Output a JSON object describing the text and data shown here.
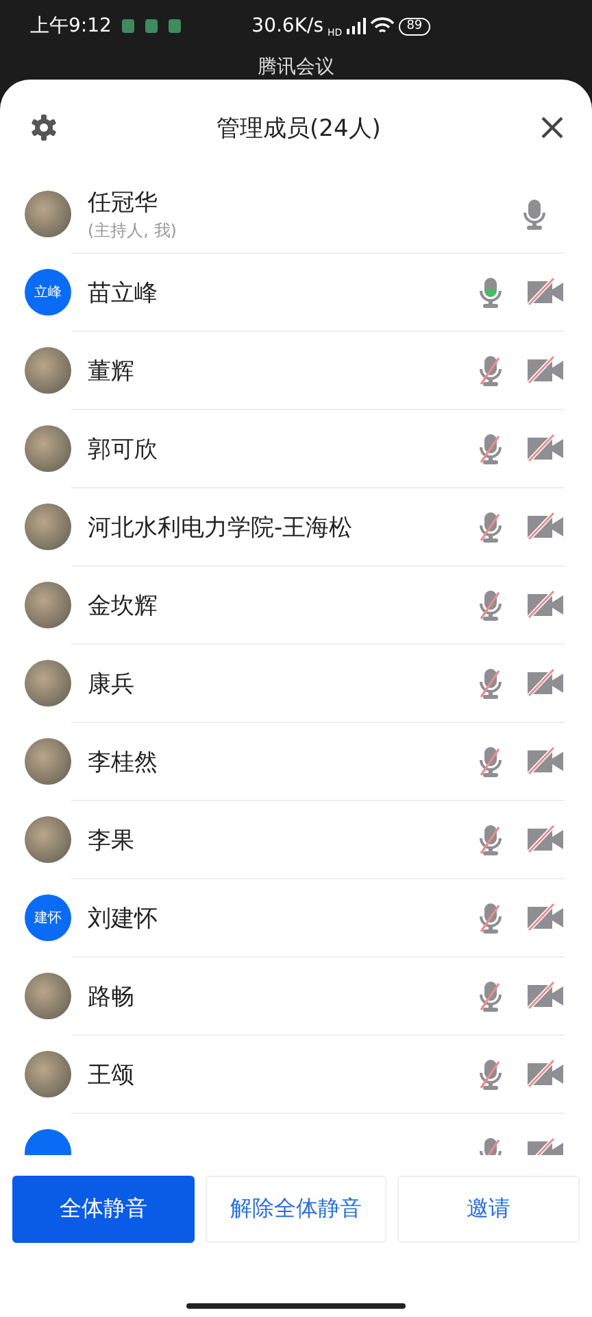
{
  "status_bar": {
    "time": "上午9:12",
    "speed": "30.6K/s",
    "network": "HD",
    "battery": "89"
  },
  "meeting": {
    "title": "腾讯会议"
  },
  "sheet": {
    "title": "管理成员(24人)"
  },
  "members": [
    {
      "name": "任冠华",
      "note": "(主持人, 我)",
      "avatar": {
        "kind": "photo"
      },
      "kind": "host",
      "muted": false,
      "speaking": false
    },
    {
      "name": "苗立峰",
      "avatar": {
        "kind": "initials",
        "text": "立峰"
      },
      "kind": "attendee",
      "muted": false,
      "speaking": true,
      "camera_off": true
    },
    {
      "name": "董辉",
      "avatar": {
        "kind": "photo"
      },
      "kind": "attendee",
      "muted": true,
      "speaking": false,
      "camera_off": true
    },
    {
      "name": "郭可欣",
      "avatar": {
        "kind": "photo"
      },
      "kind": "attendee",
      "muted": true,
      "speaking": false,
      "camera_off": true
    },
    {
      "name": "河北水利电力学院-王海松",
      "avatar": {
        "kind": "photo"
      },
      "kind": "attendee",
      "muted": true,
      "speaking": false,
      "camera_off": true
    },
    {
      "name": "金坎辉",
      "avatar": {
        "kind": "photo"
      },
      "kind": "attendee",
      "muted": true,
      "speaking": false,
      "camera_off": true
    },
    {
      "name": "康兵",
      "avatar": {
        "kind": "photo"
      },
      "kind": "attendee",
      "muted": true,
      "speaking": false,
      "camera_off": true
    },
    {
      "name": "李桂然",
      "avatar": {
        "kind": "photo"
      },
      "kind": "attendee",
      "muted": true,
      "speaking": false,
      "camera_off": true
    },
    {
      "name": "李果",
      "avatar": {
        "kind": "photo"
      },
      "kind": "attendee",
      "muted": true,
      "speaking": false,
      "camera_off": true
    },
    {
      "name": "刘建怀",
      "avatar": {
        "kind": "initials",
        "text": "建怀"
      },
      "kind": "attendee",
      "muted": true,
      "speaking": false,
      "camera_off": true
    },
    {
      "name": "路畅",
      "avatar": {
        "kind": "photo"
      },
      "kind": "attendee",
      "muted": true,
      "speaking": false,
      "camera_off": true
    },
    {
      "name": "王颂",
      "avatar": {
        "kind": "photo"
      },
      "kind": "attendee",
      "muted": true,
      "speaking": false,
      "camera_off": true
    },
    {
      "avatar": {
        "kind": "initials"
      },
      "kind": "attendee",
      "muted": true,
      "speaking": false,
      "camera_off": true
    }
  ],
  "actions": [
    {
      "label": "全体静音",
      "kind": "primary"
    },
    {
      "label": "解除全体静音",
      "kind": "secondary"
    },
    {
      "label": "邀请",
      "kind": "secondary"
    }
  ]
}
